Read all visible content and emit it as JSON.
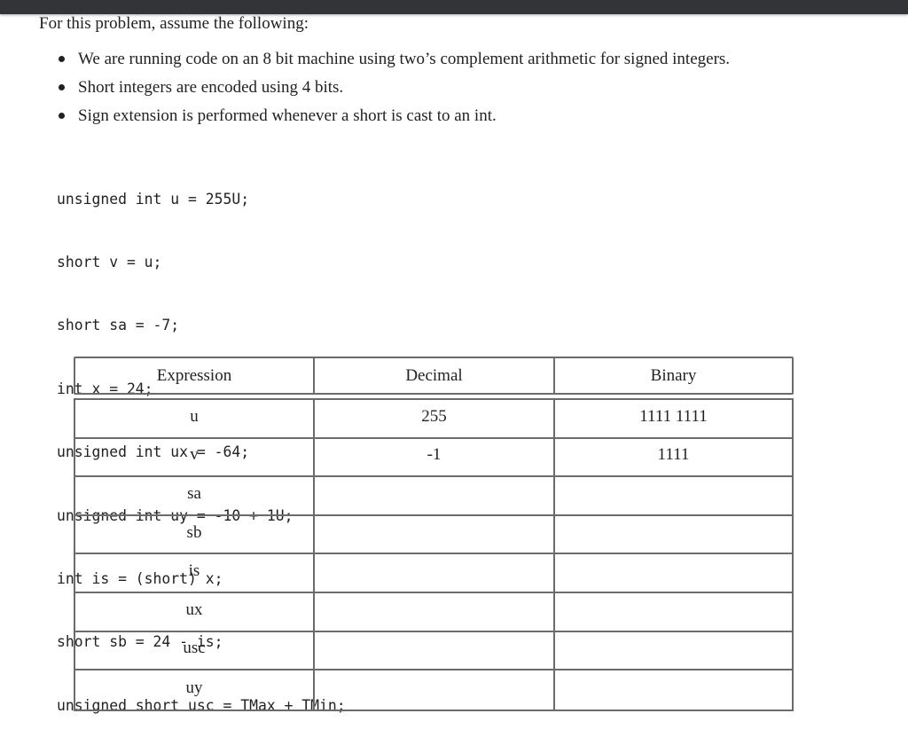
{
  "window": {
    "topbar_color": "#323437"
  },
  "intro": "For this problem, assume the following:",
  "assumptions": [
    "We are running code on an 8 bit machine using two’s complement arithmetic for signed integers.",
    "Short integers are encoded using 4 bits.",
    "Sign extension is performed whenever a short is cast to an int."
  ],
  "code_lines": [
    "unsigned int u = 255U;",
    "short v = u;",
    "short sa = -7;",
    "int x = 24;",
    "unsigned int ux = -64;",
    "unsigned int uy = -10 + 1U;",
    "int is = (short) x;",
    "short sb = 24 - is;",
    "unsigned short usc = TMax + TMin;"
  ],
  "table": {
    "headers": [
      "Expression",
      "Decimal",
      "Binary"
    ],
    "rows": [
      {
        "expression": "u",
        "decimal": "255",
        "binary": "1111 1111"
      },
      {
        "expression": "v",
        "decimal": "-1",
        "binary": "1111"
      },
      {
        "expression": "sa",
        "decimal": "",
        "binary": ""
      },
      {
        "expression": "sb",
        "decimal": "",
        "binary": ""
      },
      {
        "expression": "is",
        "decimal": "",
        "binary": ""
      },
      {
        "expression": "ux",
        "decimal": "",
        "binary": ""
      },
      {
        "expression": "usc",
        "decimal": "",
        "binary": ""
      },
      {
        "expression": "uy",
        "decimal": "",
        "binary": ""
      }
    ]
  }
}
